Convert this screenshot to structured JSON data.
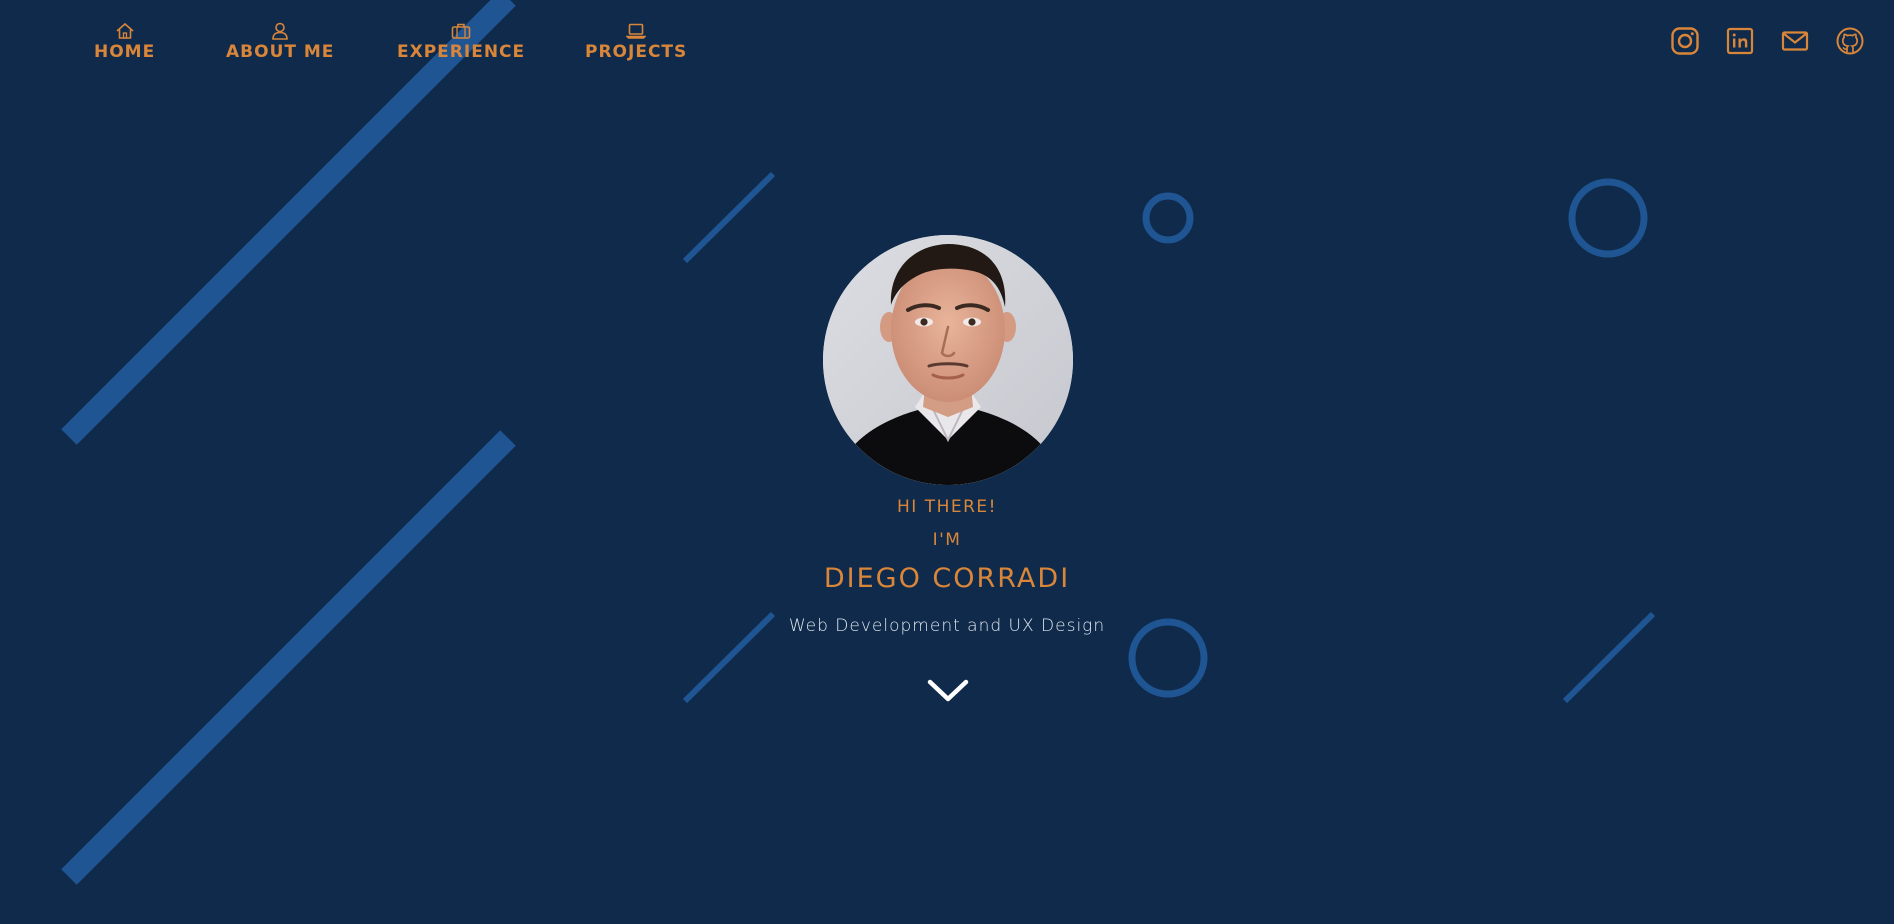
{
  "colors": {
    "background": "#0f2a4a",
    "accent": "#d9863a",
    "shape": "#1f5592",
    "subtitle_text": "#dfe6ee"
  },
  "nav": {
    "items": [
      {
        "label": "HOME",
        "icon": "home-icon"
      },
      {
        "label": "ABOUT ME",
        "icon": "user-icon"
      },
      {
        "label": "EXPERIENCE",
        "icon": "briefcase-icon"
      },
      {
        "label": "PROJECTS",
        "icon": "laptop-icon"
      }
    ]
  },
  "social": {
    "items": [
      {
        "icon": "instagram-icon"
      },
      {
        "icon": "linkedin-icon"
      },
      {
        "icon": "mail-icon"
      },
      {
        "icon": "github-icon"
      }
    ]
  },
  "hero": {
    "greeting": "HI THERE!",
    "intro": "I'M",
    "name": "DIEGO CORRADI",
    "subtitle": "Web Development and UX Design",
    "scroll_icon": "chevron-down-icon",
    "avatar_icon": "avatar-photo"
  }
}
